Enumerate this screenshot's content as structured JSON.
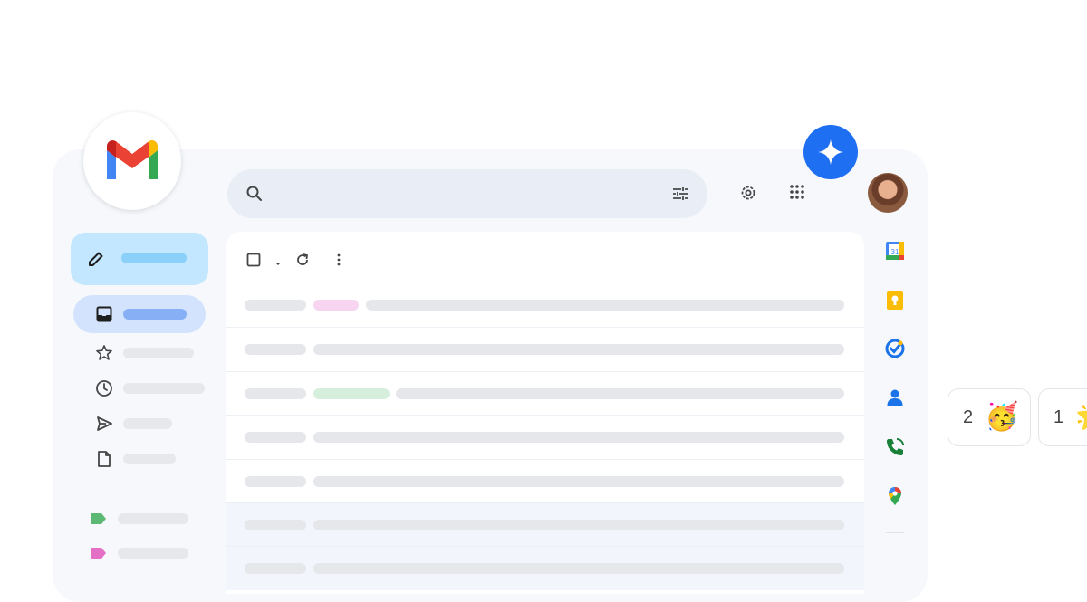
{
  "colors": {
    "background": "#ffffff",
    "app_surface": "#f6f8fc",
    "compose": "#c2e7ff",
    "active_nav": "#d3e3fd",
    "search": "#e9eef6",
    "gemini": "#1f6ff2"
  },
  "logo": {
    "icon": "gmail-m-icon"
  },
  "compose": {
    "icon": "pencil-icon"
  },
  "sidebar": {
    "items": [
      {
        "icon": "inbox-icon",
        "active": true
      },
      {
        "icon": "star-icon"
      },
      {
        "icon": "clock-icon"
      },
      {
        "icon": "send-icon"
      },
      {
        "icon": "draft-icon"
      }
    ],
    "labels": [
      {
        "color": "#5bb974"
      },
      {
        "color": "#e46fc6"
      }
    ]
  },
  "search": {
    "icon": "search-icon",
    "filter_icon": "tune-icon"
  },
  "header": {
    "icons": [
      "settings-gear-icon",
      "apps-grid-icon"
    ],
    "gemini_icon": "gemini-sparkle-icon",
    "avatar": "user-avatar"
  },
  "toolbar": {
    "icons": [
      "checkbox-icon",
      "dropdown-caret-icon",
      "refresh-icon",
      "more-vert-icon"
    ]
  },
  "side_rail": {
    "icons": [
      "calendar-icon",
      "keep-icon",
      "tasks-icon",
      "contacts-icon",
      "voice-icon",
      "maps-icon"
    ]
  },
  "reactions": [
    {
      "count": "2",
      "emoji": "🥳"
    },
    {
      "count": "1",
      "emoji": "🌟"
    }
  ]
}
